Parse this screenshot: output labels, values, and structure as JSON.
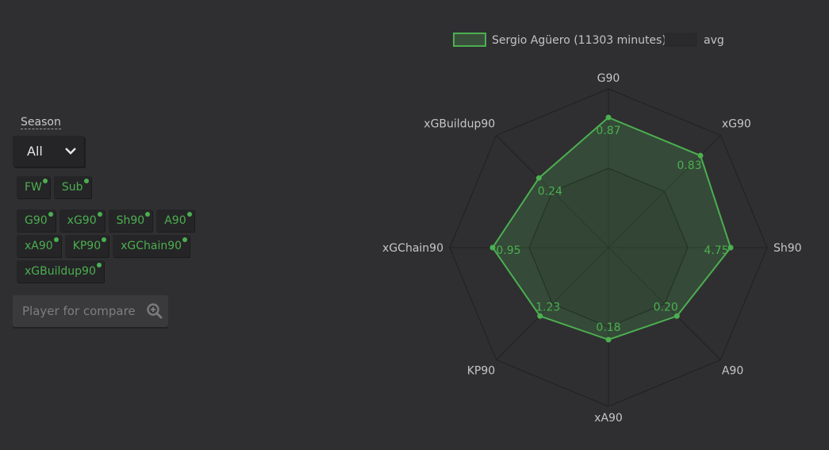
{
  "sidebar": {
    "season_label": "Season",
    "season_value": "All",
    "position_chips": [
      {
        "label": "FW",
        "active": true
      },
      {
        "label": "Sub",
        "active": true
      }
    ],
    "metric_chips": [
      {
        "label": "G90",
        "active": true
      },
      {
        "label": "xG90",
        "active": true
      },
      {
        "label": "Sh90",
        "active": true
      },
      {
        "label": "A90",
        "active": true
      },
      {
        "label": "xA90",
        "active": true
      },
      {
        "label": "KP90",
        "active": true
      },
      {
        "label": "xGChain90",
        "active": true
      },
      {
        "label": "xGBuildup90",
        "active": true
      }
    ],
    "compare_placeholder": "Player for compare",
    "compare_icon": "zoom-in-search-icon"
  },
  "colors": {
    "accent": "#4caf50",
    "player_fill": "#3a4f3b",
    "avg_fill": "#2a2a2c",
    "grid": "#202022",
    "background": "#2f2f31"
  },
  "chart_data": {
    "type": "radar",
    "legend": {
      "position": "top",
      "entries": [
        {
          "name": "Sergio Agüero (11303 minutes)",
          "style": "player"
        },
        {
          "name": "avg",
          "style": "avg"
        }
      ]
    },
    "axes": [
      "G90",
      "xG90",
      "Sh90",
      "A90",
      "xA90",
      "KP90",
      "xGChain90",
      "xGBuildup90"
    ],
    "range": [
      0,
      1
    ],
    "grid_levels": 2,
    "series": [
      {
        "name": "Sergio Agüero (11303 minutes)",
        "values": [
          0.87,
          0.83,
          4.75,
          0.2,
          0.18,
          1.23,
          0.95,
          0.24
        ],
        "labels": [
          "0.87",
          "0.83",
          "4.75",
          "0.20",
          "0.18",
          "1.23",
          "0.95",
          "0.24"
        ],
        "normalized": [
          0.82,
          0.82,
          0.77,
          0.61,
          0.58,
          0.61,
          0.73,
          0.62
        ]
      },
      {
        "name": "avg",
        "normalized": [
          0.5,
          0.5,
          0.5,
          0.5,
          0.5,
          0.5,
          0.5,
          0.5
        ]
      }
    ]
  }
}
